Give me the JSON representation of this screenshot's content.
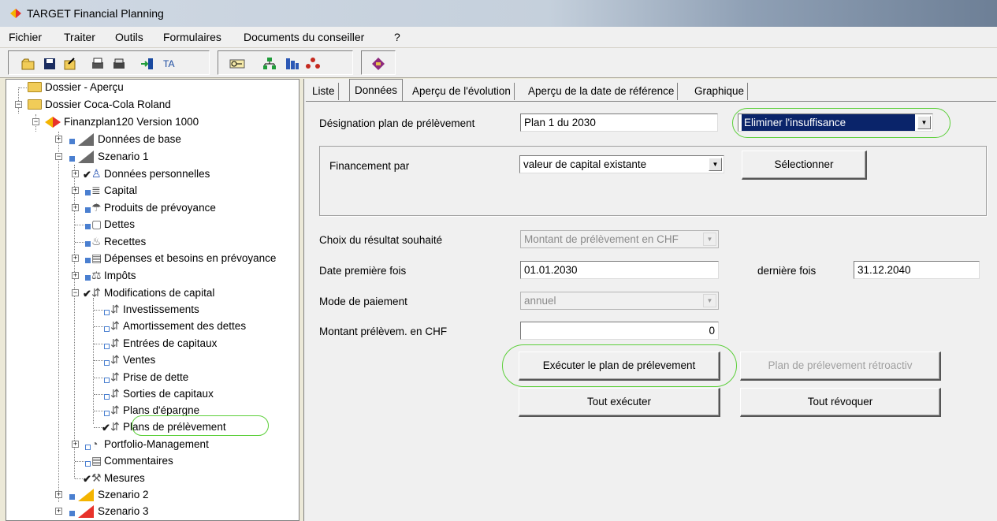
{
  "window": {
    "title": "TARGET Financial Planning"
  },
  "menu": [
    "Fichier",
    "Traiter",
    "Outils",
    "Formulaires",
    "Documents du conseiller",
    "?"
  ],
  "toolbar": {
    "icons": [
      "new-folder-icon",
      "save-icon",
      "open-icon",
      "print-preview-icon",
      "print-icon",
      "import-icon",
      "text-icon",
      "key-icon",
      "org-tree-icon",
      "org-chart-icon",
      "people-icon",
      "book-icon"
    ]
  },
  "tree": {
    "items": [
      {
        "label": "Dossier - Aperçu"
      },
      {
        "label": "Dossier Coca-Cola Roland"
      },
      {
        "label": "Finanzplan120 Version 1000"
      },
      {
        "label": "Données de base"
      },
      {
        "label": "Szenario 1"
      },
      {
        "label": "Données personnelles"
      },
      {
        "label": "Capital"
      },
      {
        "label": "Produits de prévoyance"
      },
      {
        "label": "Dettes"
      },
      {
        "label": "Recettes"
      },
      {
        "label": "Dépenses et besoins en prévoyance"
      },
      {
        "label": "Impôts"
      },
      {
        "label": "Modifications de capital"
      },
      {
        "label": "Investissements"
      },
      {
        "label": "Amortissement des dettes"
      },
      {
        "label": "Entrées de capitaux"
      },
      {
        "label": "Ventes"
      },
      {
        "label": "Prise de dette"
      },
      {
        "label": "Sorties de capitaux"
      },
      {
        "label": "Plans d'épargne"
      },
      {
        "label": "Plans de prélèvement"
      },
      {
        "label": "Portfolio-Management"
      },
      {
        "label": "Commentaires"
      },
      {
        "label": "Mesures"
      },
      {
        "label": "Szenario 2"
      },
      {
        "label": "Szenario 3"
      }
    ]
  },
  "tabs": [
    {
      "label": "Liste"
    },
    {
      "label": "Données"
    },
    {
      "label": "Aperçu de l'évolution"
    },
    {
      "label": "Aperçu de la date de référence"
    },
    {
      "label": "Graphique"
    }
  ],
  "form": {
    "designation_label": "Désignation plan de prélèvement",
    "designation_value": "Plan 1 du 2030",
    "mode_value": "Eliminer l'insuffisance",
    "financement_label": "Financement par",
    "financement_value": "valeur de capital existante",
    "select_button": "Sélectionner",
    "choix_label": "Choix du résultat souhaité",
    "choix_value": "Montant de prélèvement en CHF",
    "date_first_label": "Date première fois",
    "date_first_value": "01.01.2030",
    "date_last_label": "dernière fois",
    "date_last_value": "31.12.2040",
    "mode_paiement_label": "Mode de paiement",
    "mode_paiement_value": "annuel",
    "montant_label": "Montant prélèvem. en CHF",
    "montant_value": "0",
    "execute_button": "Exécuter le plan de prélevement",
    "retroactive_button": "Plan de prélevement rétroactiv",
    "execute_all_button": "Tout exécuter",
    "revoke_all_button": "Tout révoquer"
  },
  "colors": {
    "highlight_ring": "#5ccf3a",
    "selection": "#0a246a"
  }
}
